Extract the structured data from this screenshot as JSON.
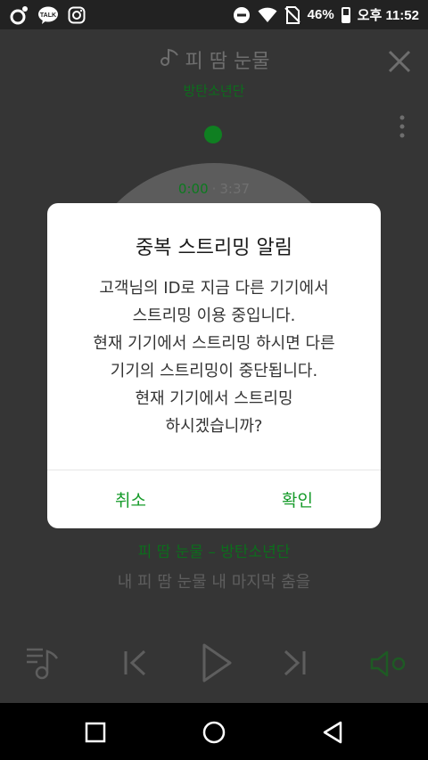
{
  "status": {
    "battery_pct": "46%",
    "battery_level": 0.46,
    "time": "오후 11:52",
    "icons": [
      "circle-app-icon",
      "kakaotalk-icon",
      "instagram-icon",
      "dnd-icon",
      "wifi-icon",
      "no-sim-icon",
      "battery-icon"
    ],
    "kakao_label": "TALK"
  },
  "player": {
    "title": "피 땀 눈물",
    "artist": "방탄소년단",
    "current_time": "0:00",
    "separator": "·",
    "duration": "3:37",
    "lyric_title": "피 땀 눈물 – 방탄소년단",
    "lyric_line": "내 피 땀 눈물 내 마지막 춤을",
    "accent_color": "#169b2a"
  },
  "dialog": {
    "title": "중복 스트리밍 알림",
    "lines": [
      "고객님의 ID로 지금 다른 기기에서",
      "스트리밍 이용 중입니다.",
      "현재 기기에서 스트리밍 하시면 다른",
      "기기의 스트리밍이 중단됩니다.",
      "현재 기기에서 스트리밍",
      "하시겠습니까?"
    ],
    "cancel_label": "취소",
    "ok_label": "확인"
  },
  "navbar": {
    "buttons": [
      "recents-icon",
      "home-icon",
      "back-icon"
    ]
  }
}
